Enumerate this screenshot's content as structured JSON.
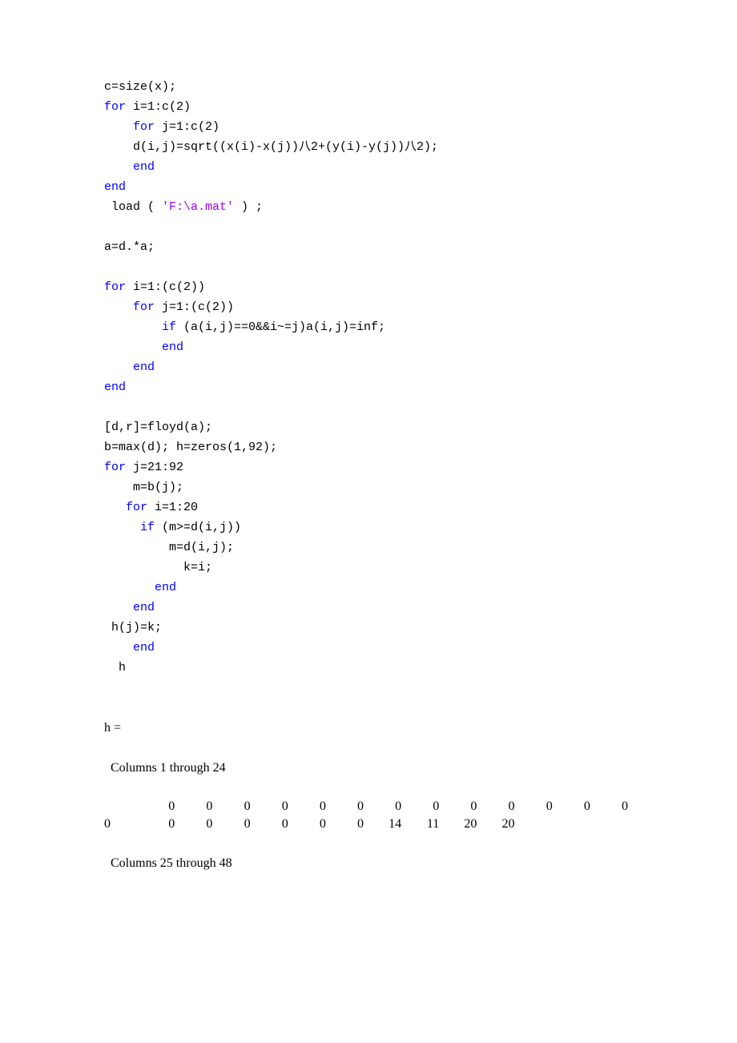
{
  "code": {
    "l1": "c=size(x);",
    "l2a": "for",
    "l2b": " i=1:c(2)",
    "l3a": "    for",
    "l3b": " j=1:c(2)",
    "l4": "    d(i,j)=sqrt((x(i)-x(j))八2+(y(i)-y(j))八2);",
    "l5": "    end",
    "l6": "end",
    "l7a": " load ( ",
    "l7b": "'F:\\a.mat'",
    "l7c": " ) ;",
    "l8": "a=d.*a;",
    "l9a": "for",
    "l9b": " i=1:(c(2))",
    "l10a": "    for",
    "l10b": " j=1:(c(2))",
    "l11a": "        if",
    "l11b": " (a(i,j)==0&&i~=j)a(i,j)=inf;",
    "l12": "        end",
    "l13": "    end",
    "l14": "end",
    "l15": "[d,r]=floyd(a);",
    "l16": "b=max(d); h=zeros(1,92);",
    "l17a": "for",
    "l17b": " j=21:92",
    "l18": "    m=b(j);",
    "l19a": "   for",
    "l19b": " i=1:20",
    "l20a": "     if",
    "l20b": " (m>=d(i,j))",
    "l21": "         m=d(i,j);",
    "l22": "           k=i;",
    "l23": "       end",
    "l24": "    end",
    "l25": " h(j)=k;",
    "l26": "    end",
    "l27": "  h"
  },
  "out": {
    "hvar": "h =",
    "sec1": "  Columns 1 through 24",
    "sec2": "  Columns 25 through 48",
    "row1": [
      "",
      "0",
      "0",
      "0",
      "0",
      "0",
      "0",
      "0",
      "0",
      "0",
      "0",
      "0",
      "0",
      "0"
    ],
    "row2": [
      "0",
      "0",
      "0",
      "0",
      "0",
      "0",
      "0",
      "14",
      "11",
      "20",
      "20",
      "",
      "",
      ""
    ]
  }
}
